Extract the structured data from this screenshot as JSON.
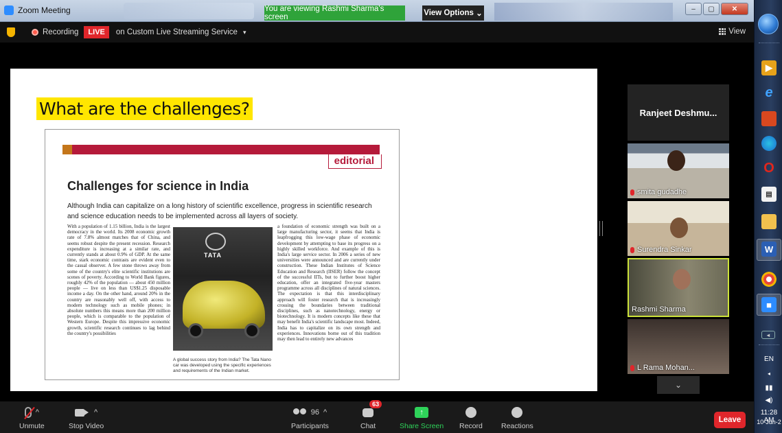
{
  "window": {
    "title": "Zoom Meeting",
    "viewing_banner": "You are viewing Rashmi Sharma's screen",
    "view_options": "View Options",
    "view_options_caret": "⌄",
    "min": "–",
    "max": "▢",
    "close": "✕"
  },
  "topbar": {
    "recording": "Recording",
    "live": "LIVE",
    "stream": "on Custom Live Streaming Service",
    "stream_caret": "▾",
    "view": "View"
  },
  "slide": {
    "title": "What are the challenges?",
    "editorial": "editorial",
    "headline": "Challenges for science in India",
    "dek": "Although India can capitalize on a long history of scientific excellence, progress in scientific research and science education needs to be implemented across all layers of society.",
    "col_left": "With a population of 1.15 billion, India is the largest democracy in the world. Its 2008 economic growth rate of 7.8% almost matches that of China, and seems robust despite the present recession. Research expenditure is increasing at a similar rate, and currently stands at about 0.9% of GDP. At the same time, stark economic contrasts are evident even to the casual observer. A few stone throws away from some of the country's elite scientific institutions are scenes of poverty. According to World Bank figures, roughly 42% of the population — about 450 million people — live on less than US$1.25 disposable income a day. On the other hand, around 20% in the country are reasonably well off, with access to modern technology such as mobile phones; in absolute numbers this means more than 200 million people, which is comparable to the population of Western Europe. Despite this impressive economic growth, scientific research continues to lag behind the country's possibilities",
    "col_right": "a foundation of economic strength was built on a large manufacturing sector, it seems that India is leapfrogging this low-wage phase of economic development by attempting to base its progress on a highly skilled workforce. And example of this is India's large service sector. In 2006 a series of new universities were announced and are currently under construction. These Indian Institutes of Science Education and Research (IISER) follow the concept of the successful IITs, but to further boost higher education, offer an integrated five-year masters programme across all disciplines of natural sciences. The expectation is that this interdisciplinary approach will foster research that is increasingly crossing the boundaries between traditional disciplines, such as nanotechnology, energy or biotechnology. It is modern concepts like these that may benefit India's scientific landscape most. Indeed, India has to capitalize on its own strength and experiences. Innovations borne out of this tradition may then lead to entirely new advances",
    "photo_brand": "TATA",
    "caption": "A global success story from India? The Tata Nano car was developed using the specific experiences and requirements of the Indian market."
  },
  "participants": [
    {
      "name": "Ranjeet  Deshmu..."
    },
    {
      "name": "smita gudadhe"
    },
    {
      "name": "Surendra Sinkar"
    },
    {
      "name": "Rashmi Sharma"
    },
    {
      "name": "L Rama Mohan..."
    }
  ],
  "gallery_more": "⌄",
  "toolbar": {
    "unmute": "Unmute",
    "stop_video": "Stop Video",
    "participants": "Participants",
    "participants_count": "96",
    "chat": "Chat",
    "chat_badge": "63",
    "share_screen": "Share Screen",
    "share_arrow": "↑",
    "record": "Record",
    "reactions": "Reactions",
    "leave": "Leave",
    "caret": "^"
  },
  "taskbar": {
    "lang": "EN",
    "time": "11:28 AM",
    "date": "10-Jun-2"
  },
  "colors": {
    "live": "#e0262b",
    "banner": "#2fa33a",
    "highlight": "#ffe600",
    "editorial": "#b51a3a",
    "active_speaker": "#cde33a"
  }
}
